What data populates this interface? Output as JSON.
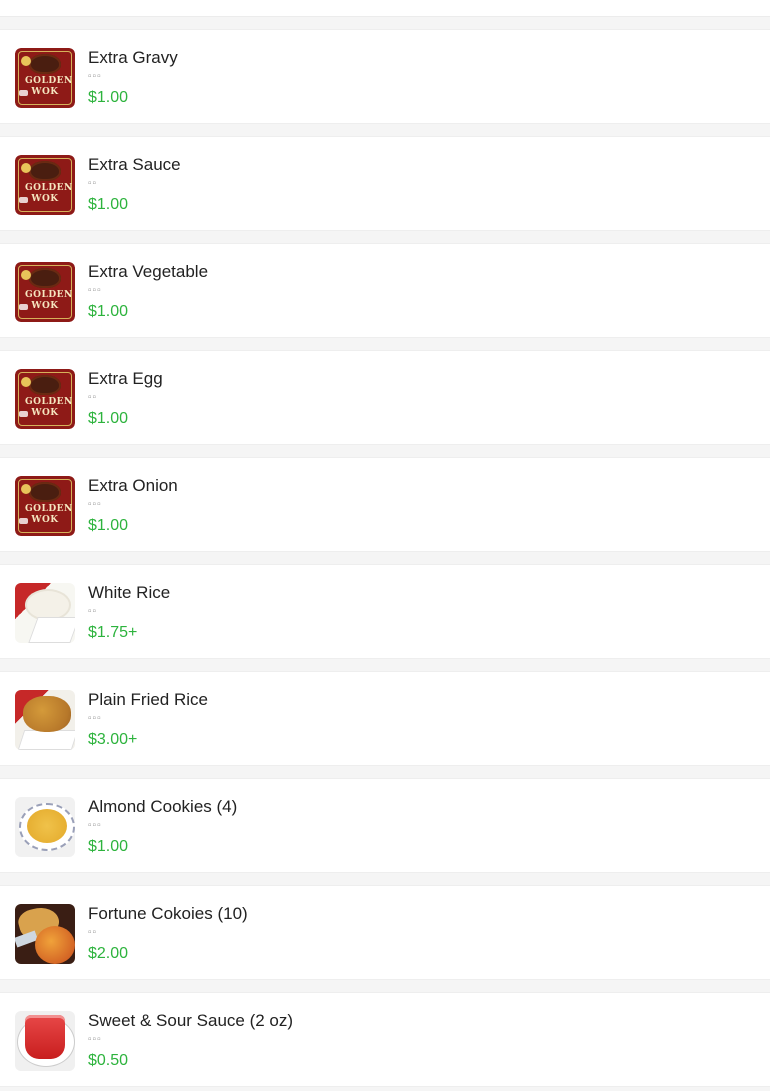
{
  "colors": {
    "price_green": "#2db33d",
    "name_text": "#222222",
    "sub_text": "#999999",
    "page_background": "#f5f5f5"
  },
  "menu": {
    "items": [
      {
        "name": "Extra Gravy",
        "subtitle": "▫▫▫",
        "price": "$1.00",
        "image": "golden-wok-logo"
      },
      {
        "name": "Extra Sauce",
        "subtitle": "▫▫",
        "price": "$1.00",
        "image": "golden-wok-logo"
      },
      {
        "name": "Extra Vegetable",
        "subtitle": "▫▫▫",
        "price": "$1.00",
        "image": "golden-wok-logo"
      },
      {
        "name": "Extra Egg",
        "subtitle": "▫▫",
        "price": "$1.00",
        "image": "golden-wok-logo"
      },
      {
        "name": "Extra Onion",
        "subtitle": "▫▫▫",
        "price": "$1.00",
        "image": "golden-wok-logo"
      },
      {
        "name": "White Rice",
        "subtitle": "▫▫",
        "price": "$1.75+",
        "image": "white-rice-photo"
      },
      {
        "name": "Plain Fried Rice",
        "subtitle": "▫▫▫",
        "price": "$3.00+",
        "image": "fried-rice-photo"
      },
      {
        "name": "Almond Cookies (4)",
        "subtitle": "▫▫▫",
        "price": "$1.00",
        "image": "almond-cookie-photo"
      },
      {
        "name": "Fortune Cokoies (10)",
        "subtitle": "▫▫",
        "price": "$2.00",
        "image": "fortune-cookie-photo"
      },
      {
        "name": "Sweet & Sour Sauce (2 oz)",
        "subtitle": "▫▫▫",
        "price": "$0.50",
        "image": "sauce-cup-photo"
      }
    ]
  }
}
